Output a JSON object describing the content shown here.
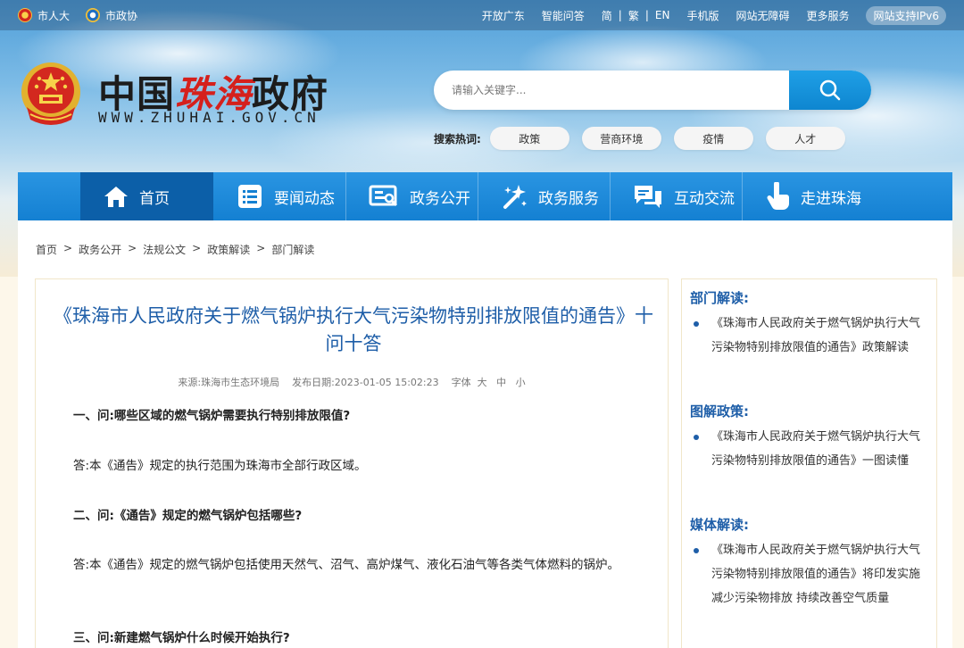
{
  "topbar": {
    "left_links": [
      {
        "label": "市人大",
        "icon": "emblem-icon"
      },
      {
        "label": "市政协",
        "icon": "cppcc-emblem-icon"
      }
    ],
    "right_links": [
      "开放广东",
      "智能问答"
    ],
    "lang": [
      "简",
      "繁",
      "EN"
    ],
    "right_links2": [
      "手机版",
      "网站无障碍",
      "更多服务"
    ],
    "ipv6_badge": "网站支持IPv6"
  },
  "logo": {
    "title_pre": "中国",
    "title_red": "珠海",
    "title_post": "政府",
    "url": "WWW.ZHUHAI.GOV.CN"
  },
  "search": {
    "placeholder": "请输入关键字...",
    "hot_label": "搜索热词:",
    "hot_words": [
      "政策",
      "营商环境",
      "疫情",
      "人才"
    ]
  },
  "nav": {
    "items": [
      {
        "label": "首页",
        "icon": "home-icon"
      },
      {
        "label": "要闻动态",
        "icon": "news-list-icon"
      },
      {
        "label": "政务公开",
        "icon": "open-government-icon"
      },
      {
        "label": "政务服务",
        "icon": "service-magic-icon"
      },
      {
        "label": "互动交流",
        "icon": "chat-bubble-icon"
      },
      {
        "label": "走进珠海",
        "icon": "hand-pointer-icon"
      }
    ]
  },
  "breadcrumb": [
    "首页",
    "政务公开",
    "法规公文",
    "政策解读",
    "部门解读"
  ],
  "breadcrumb_sep": ">",
  "article": {
    "title": "《珠海市人民政府关于燃气锅炉执行大气污染物特别排放限值的通告》十问十答",
    "meta": "来源:珠海市生态环境局    发布日期:2023-01-05 15:02:23    字体  大   中   小",
    "paragraphs": [
      {
        "type": "q",
        "text": "一、问:哪些区域的燃气锅炉需要执行特别排放限值?"
      },
      {
        "type": "a",
        "text": "答:本《通告》规定的执行范围为珠海市全部行政区域。"
      },
      {
        "type": "q",
        "text": "二、问:《通告》规定的燃气锅炉包括哪些?"
      },
      {
        "type": "a",
        "text": "答:本《通告》规定的燃气锅炉包括使用天然气、沼气、高炉煤气、液化石油气等各类气体燃料的锅炉。"
      },
      {
        "type": "q",
        "text": "三、问:新建燃气锅炉什么时候开始执行?"
      }
    ]
  },
  "sidebar": {
    "sections": [
      {
        "heading": "部门解读:",
        "items": [
          "《珠海市人民政府关于燃气锅炉执行大气污染物特别排放限值的通告》政策解读"
        ]
      },
      {
        "heading": "图解政策:",
        "items": [
          "《珠海市人民政府关于燃气锅炉执行大气污染物特别排放限值的通告》一图读懂"
        ]
      },
      {
        "heading": "媒体解读:",
        "items": [
          "《珠海市人民政府关于燃气锅炉执行大气污染物特别排放限值的通告》将印发实施 减少污染物排放 持续改善空气质量"
        ]
      }
    ]
  },
  "colors": {
    "nav_blue": "#1480d2",
    "nav_active": "#0c5fa8",
    "title_blue": "#1e5ea8",
    "logo_red": "#d5201c"
  }
}
